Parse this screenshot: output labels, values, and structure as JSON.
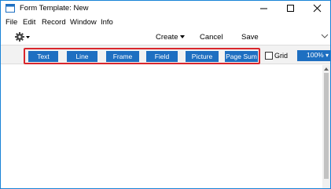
{
  "window": {
    "title": "Form Template: New",
    "accent_color": "#1e6fc1",
    "controls": {
      "minimize": "minimize-icon",
      "maximize": "maximize-icon",
      "close": "close-icon"
    }
  },
  "menu": {
    "items": [
      {
        "label": "File"
      },
      {
        "label": "Edit"
      },
      {
        "label": "Record"
      },
      {
        "label": "Window"
      },
      {
        "label": "Info"
      }
    ]
  },
  "commands": {
    "gear_icon": "gear-icon",
    "create": "Create",
    "cancel": "Cancel",
    "save": "Save"
  },
  "toolbar": {
    "buttons": [
      {
        "label": "Text"
      },
      {
        "label": "Line"
      },
      {
        "label": "Frame"
      },
      {
        "label": "Field"
      },
      {
        "label": "Picture"
      },
      {
        "label": "Page Sum"
      }
    ],
    "grid_label": "Grid",
    "grid_checked": false,
    "zoom_value": "100%",
    "highlight_color": "#d9262c"
  }
}
